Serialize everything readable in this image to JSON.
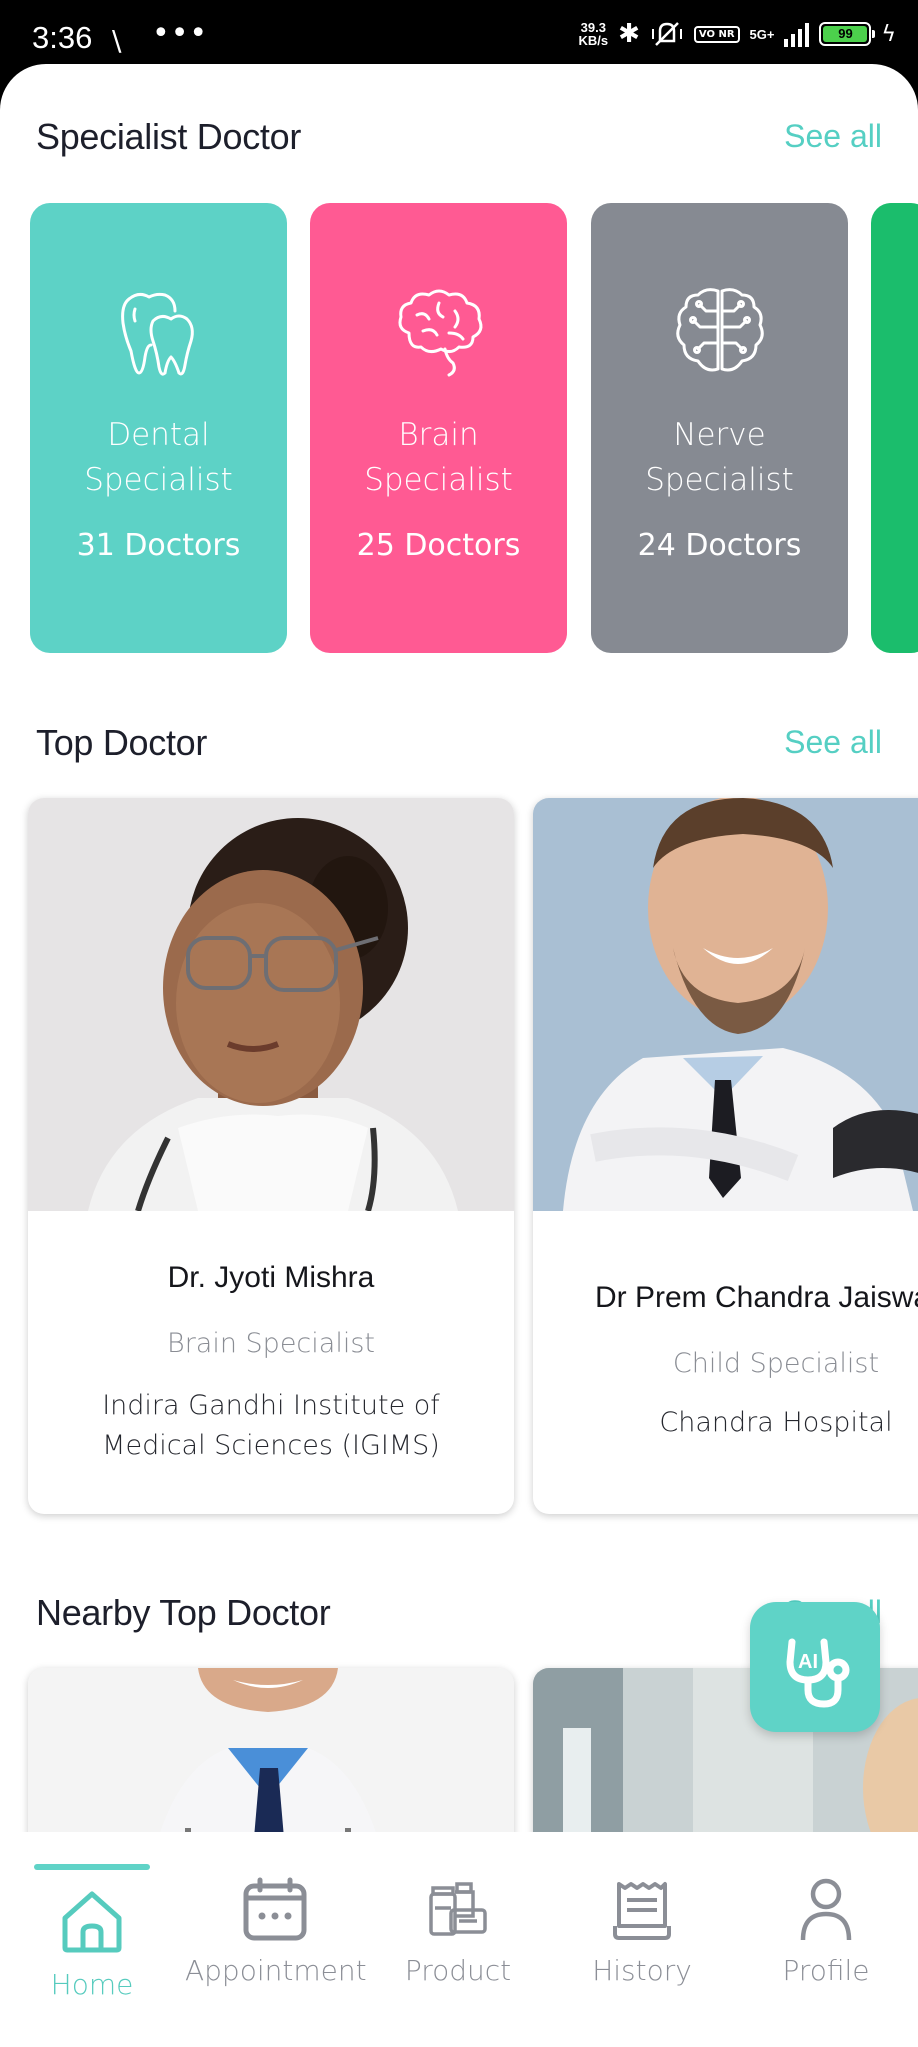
{
  "status_bar": {
    "time": "3:36",
    "signal_glyph": "\\",
    "dots": "•••",
    "speed_value": "39.3",
    "speed_unit": "KB/s",
    "vo_nr": "VO NR",
    "network": "5G+",
    "battery": "99"
  },
  "specialist": {
    "title": "Specialist Doctor",
    "see_all": "See all",
    "cards": [
      {
        "name": "Dental\nSpecialist",
        "count": "31 Doctors",
        "icon": "tooth-icon",
        "color": "#5dd2c6"
      },
      {
        "name": "Brain\nSpecialist",
        "count": "25 Doctors",
        "icon": "brain-icon",
        "color": "#ff5a93"
      },
      {
        "name": "Nerve\nSpecialist",
        "count": "24 Doctors",
        "icon": "nerve-brain-icon",
        "color": "#868a92"
      },
      {
        "name": "",
        "count": "",
        "icon": "",
        "color": "#1bbd6c"
      }
    ]
  },
  "top_doctor": {
    "title": "Top Doctor",
    "see_all": "See all",
    "doctors": [
      {
        "name": "Dr. Jyoti Mishra",
        "specialty": "Brain Specialist",
        "hospital": "Indira Gandhi Institute of Medical Sciences (IGIMS)"
      },
      {
        "name": "Dr Prem Chandra Jaiswal",
        "specialty": "Child Specialist",
        "hospital": "Chandra Hospital"
      }
    ]
  },
  "nearby": {
    "title": "Nearby Top Doctor",
    "see_all": "See all"
  },
  "fab": {
    "icon": "ai-stethoscope-icon"
  },
  "nav": {
    "items": [
      {
        "label": "Home",
        "icon": "home-icon",
        "active": true
      },
      {
        "label": "Appointment",
        "icon": "calendar-icon",
        "active": false
      },
      {
        "label": "Product",
        "icon": "medicine-bottles-icon",
        "active": false
      },
      {
        "label": "History",
        "icon": "history-document-icon",
        "active": false
      },
      {
        "label": "Profile",
        "icon": "profile-icon",
        "active": false
      }
    ],
    "active_color": "#56cbbe",
    "inactive_color": "#8b8e96"
  }
}
